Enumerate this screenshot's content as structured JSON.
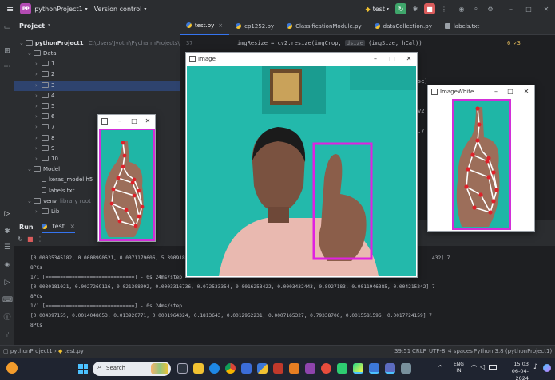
{
  "titlebar": {
    "project_badge": "PP",
    "project_name": "pythonProject1",
    "version_control": "Version control",
    "run_config": "test"
  },
  "project_panel": {
    "header": "Project",
    "root_name": "pythonProject1",
    "root_path": "C:\\Users\\Jyothi\\PycharmProjects\\pythonProject1",
    "items": [
      {
        "label": "Data",
        "indent": 1,
        "open": true
      },
      {
        "label": "1",
        "indent": 2
      },
      {
        "label": "2",
        "indent": 2
      },
      {
        "label": "3",
        "indent": 2,
        "selected": true
      },
      {
        "label": "4",
        "indent": 2
      },
      {
        "label": "5",
        "indent": 2
      },
      {
        "label": "6",
        "indent": 2
      },
      {
        "label": "7",
        "indent": 2
      },
      {
        "label": "8",
        "indent": 2
      },
      {
        "label": "9",
        "indent": 2
      },
      {
        "label": "10",
        "indent": 2
      },
      {
        "label": "Model",
        "indent": 1,
        "open": true
      },
      {
        "label": "keras_model.h5",
        "indent": 2,
        "file": true
      },
      {
        "label": "labels.txt",
        "indent": 2,
        "file": true
      },
      {
        "label": "venv",
        "indent": 1,
        "extra": "library root",
        "open": true
      },
      {
        "label": "Lib",
        "indent": 2
      }
    ]
  },
  "editor": {
    "tabs": [
      {
        "label": "test.py",
        "active": true
      },
      {
        "label": "cp1252.py"
      },
      {
        "label": "ClassificationModule.py"
      },
      {
        "label": "dataCollection.py"
      },
      {
        "label": "labels.txt"
      }
    ],
    "line_number": "37",
    "code_line": "imgResize = cv2.resize(imgCrop,",
    "code_hint": "dsize",
    "code_tail": "(imgSize, hCal))",
    "inspection": "6 ✓3",
    "right_fragment_1": "se)",
    "right_fragment_2": "v2.",
    "right_fragment_3": ",7"
  },
  "windows": {
    "image_title": "Image",
    "imagewhite_title": "ImageWhite"
  },
  "run_panel": {
    "tab_run": "Run",
    "tab_test": "test",
    "output": [
      "[0.00035345182, 0.0008990521, 0.0071179606, 5.390918e-",
      "432] 7",
      "8PCs",
      "1/1 [==============================] - 0s 24ms/step",
      "[0.0030181021, 0.0027269116, 0.021308092, 0.0003316736, 0.072533354, 0.0016253422, 0.0003432443, 0.8927183, 0.0011946385, 0.004215242] 7",
      "8PCs",
      "1/1 [==============================] - 0s 24ms/step",
      "[0.004397155, 0.0014048053, 0.013920771, 0.0001964324, 0.1813643, 0.0012952231, 0.0007165327, 0.79338706, 0.0015581596, 0.0017724159] 7",
      "8PCs"
    ]
  },
  "statusbar": {
    "breadcrumb_project": "pythonProject1",
    "breadcrumb_file": "test.py",
    "position": "39:51",
    "line_sep": "CRLF",
    "encoding": "UTF-8",
    "indent": "4 spaces",
    "interpreter": "Python 3.8 (pythonProject1)"
  },
  "taskbar": {
    "search_placeholder": "Search",
    "lang_line1": "ENG",
    "lang_line2": "IN",
    "time": "15:03",
    "date": "06-04-2024"
  }
}
